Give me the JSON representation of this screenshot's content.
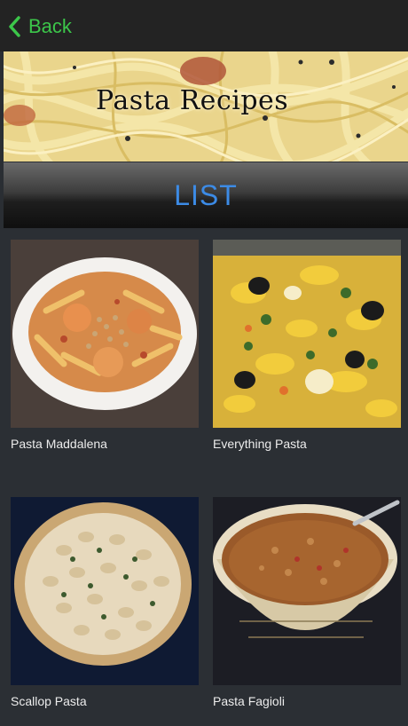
{
  "nav": {
    "back_label": "Back"
  },
  "banner": {
    "title": "Pasta Recipes"
  },
  "list_header": {
    "label": "LIST"
  },
  "recipes": [
    {
      "name": "Pasta Maddalena"
    },
    {
      "name": "Everything Pasta"
    },
    {
      "name": "Scallop Pasta"
    },
    {
      "name": "Pasta Fagioli"
    }
  ],
  "colors": {
    "back_accent": "#3cc64a",
    "list_accent": "#3c8be6",
    "background": "#2a2e33"
  },
  "icons": {
    "back": "chevron-left-icon"
  }
}
